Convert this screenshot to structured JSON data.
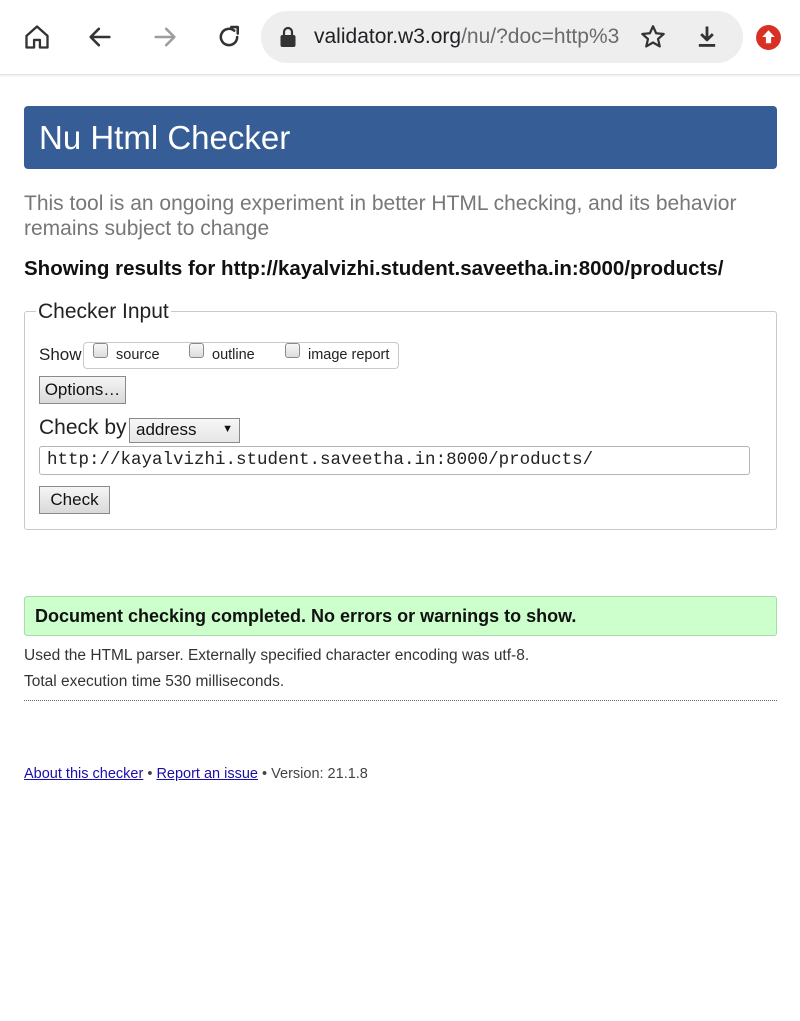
{
  "browser": {
    "url_host": "validator.w3.org",
    "url_rest": "/nu/?doc=http%3"
  },
  "page": {
    "title": "Nu Html Checker",
    "intro": "This tool is an ongoing experiment in better HTML checking, and its behavior remains subject to change",
    "showing_results": "Showing results for http://kayalvizhi.student.saveetha.in:8000/products/"
  },
  "checker_input": {
    "legend": "Checker Input",
    "show_label": "Show",
    "options": [
      {
        "label": "source",
        "checked": false
      },
      {
        "label": "outline",
        "checked": false
      },
      {
        "label": "image report",
        "checked": false
      }
    ],
    "options_button": "Options…",
    "check_by_label": "Check by",
    "check_by_value": "address",
    "url_value": "http://kayalvizhi.student.saveetha.in:8000/products/",
    "check_button": "Check"
  },
  "results": {
    "success_message": "Document checking completed. No errors or warnings to show.",
    "parser_note": "Used the HTML parser. Externally specified character encoding was utf-8.",
    "time_note": "Total execution time 530 milliseconds."
  },
  "footer": {
    "about_link": "About this checker",
    "separator": "•",
    "report_link": "Report an issue",
    "version": "Version: 21.1.8"
  },
  "colors": {
    "banner": "#365d95",
    "success_bg": "#ccffcc",
    "extension_badge": "#d93025"
  }
}
